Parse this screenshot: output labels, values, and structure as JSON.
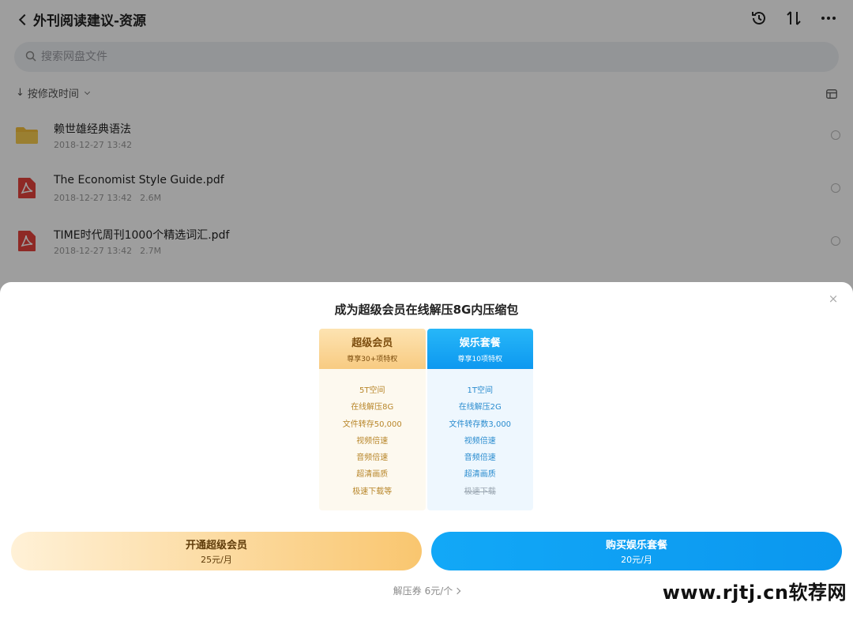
{
  "header": {
    "title": "外刊阅读建议-资源",
    "icons": [
      "history-icon",
      "transfer-icon",
      "more-icon"
    ]
  },
  "search": {
    "placeholder": "搜索网盘文件"
  },
  "sort": {
    "arrow": "↓",
    "label": "按修改时间"
  },
  "files": [
    {
      "name": "赖世雄经典语法",
      "date": "2018-12-27 13:42",
      "size": "",
      "type": "folder"
    },
    {
      "name": "The Economist Style Guide.pdf",
      "date": "2018-12-27 13:42",
      "size": "2.6M",
      "type": "pdf"
    },
    {
      "name": "TIME时代周刊1000个精选词汇.pdf",
      "date": "2018-12-27 13:42",
      "size": "2.7M",
      "type": "pdf"
    }
  ],
  "sheet": {
    "title": "成为超级会员在线解压8G内压缩包",
    "close": "×",
    "plans": {
      "svip": {
        "name": "超级会员",
        "subtitle": "尊享30+项特权",
        "features": [
          "5T空间",
          "在线解压8G",
          "文件转存50,000",
          "视频倍速",
          "音频倍速",
          "超清画质",
          "极速下载等"
        ]
      },
      "fun": {
        "name": "娱乐套餐",
        "subtitle": "尊享10项特权",
        "features": [
          "1T空间",
          "在线解压2G",
          "文件转存数3,000",
          "视频倍速",
          "音频倍速",
          "超清画质",
          "极速下载"
        ]
      }
    },
    "buttons": {
      "svip": {
        "label": "开通超级会员",
        "price": "25元/月"
      },
      "fun": {
        "label": "购买娱乐套餐",
        "price": "20元/月"
      }
    },
    "coupon": "解压券 6元/个"
  },
  "watermark": "www.rjtj.cn软荐网",
  "colors": {
    "accent_blue": "#0d98f0",
    "accent_gold": "#f8cb82",
    "pdf_red": "#e5433c",
    "folder_yellow": "#f6c03d"
  }
}
